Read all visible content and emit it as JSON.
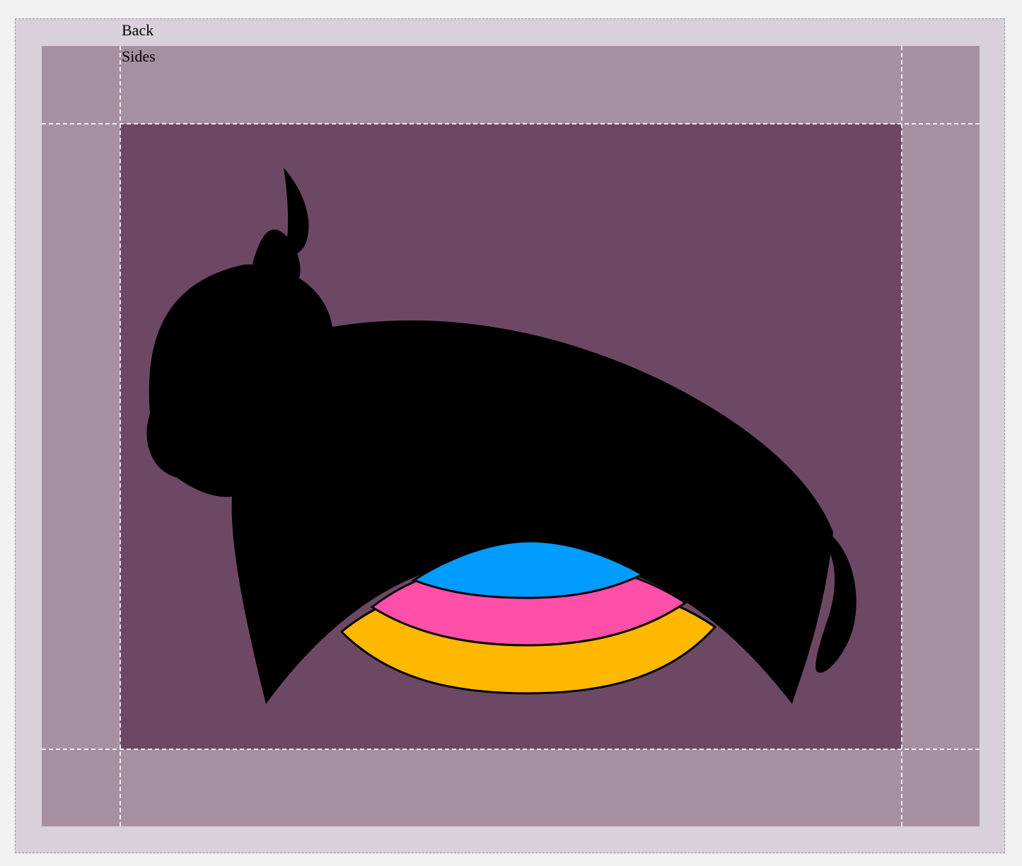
{
  "labels": {
    "back": "Back",
    "sides": "Sides"
  },
  "colors": {
    "page_background": "#f1f1f1",
    "back_zone": "#d8d1da",
    "sides_zone": "#a78fa2",
    "art_area": "#6d4865",
    "silhouette": "#000000",
    "arc_inner": "#009cff",
    "arc_middle": "#ff4fa9",
    "arc_outer": "#ffb800"
  },
  "illustration": {
    "subject": "bull-silhouette-with-rainbow-arcs"
  }
}
